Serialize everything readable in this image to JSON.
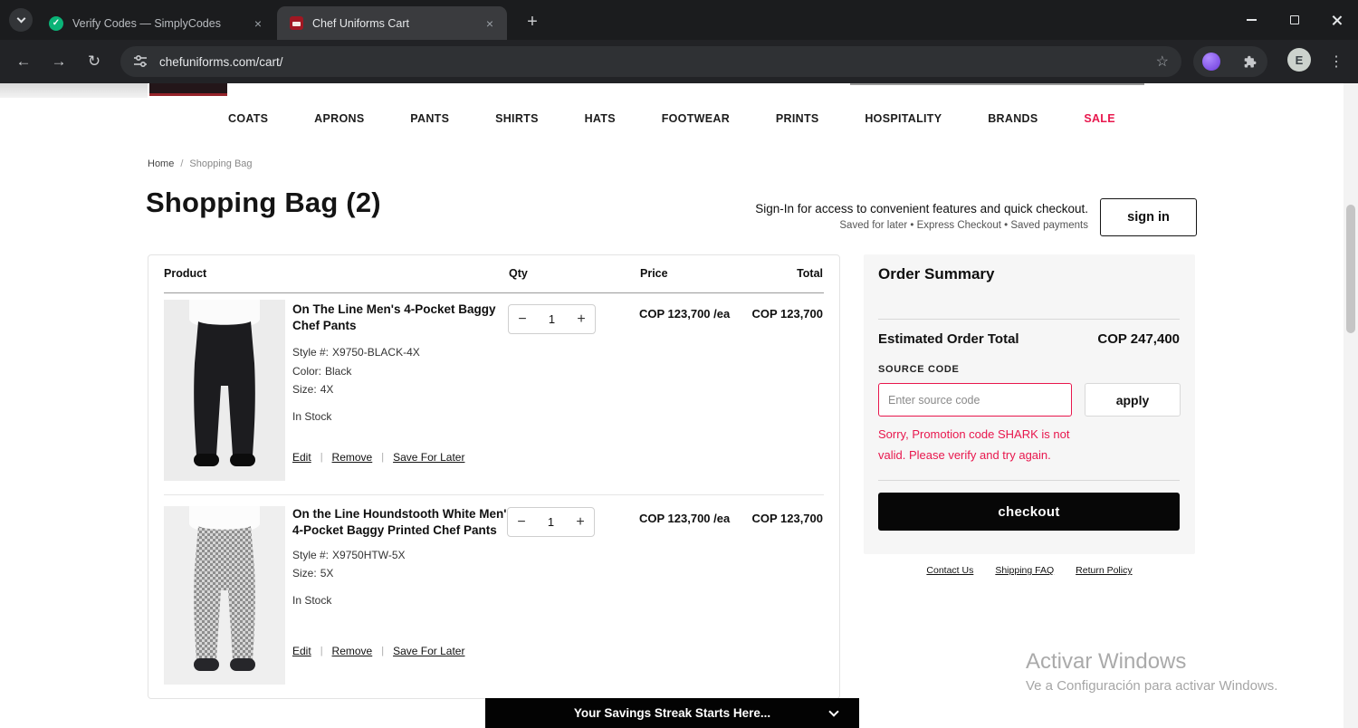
{
  "browser": {
    "tabs": [
      {
        "title": "Verify Codes — SimplyCodes"
      },
      {
        "title": "Chef Uniforms Cart"
      }
    ],
    "url": "chefuniforms.com/cart/",
    "avatar": "E"
  },
  "icons": {
    "back": "←",
    "forward": "→",
    "reload": "↻",
    "star": "☆",
    "more": "⋮",
    "new_tab": "+",
    "close": "×",
    "check": "✓",
    "minus": "−",
    "plus": "+"
  },
  "nav": {
    "items": [
      "COATS",
      "APRONS",
      "PANTS",
      "SHIRTS",
      "HATS",
      "FOOTWEAR",
      "PRINTS",
      "HOSPITALITY",
      "BRANDS",
      "SALE"
    ]
  },
  "breadcrumb": {
    "home": "Home",
    "separator": "/",
    "current": "Shopping Bag"
  },
  "page": {
    "title": "Shopping Bag (2)"
  },
  "signin": {
    "line1": "Sign-In for access to convenient features and quick checkout.",
    "line2": "Saved for later   •   Express Checkout   •   Saved payments",
    "button": "sign in"
  },
  "cart": {
    "headers": {
      "product": "Product",
      "qty": "Qty",
      "price": "Price",
      "total": "Total"
    },
    "link_sep": "|",
    "links": {
      "edit": "Edit",
      "remove": "Remove",
      "save": "Save For Later"
    },
    "items": [
      {
        "title": "On The Line Men's 4-Pocket Baggy Chef Pants",
        "style_label": "Style #:",
        "style_value": "X9750-BLACK-4X",
        "color_label": "Color:",
        "color_value": "Black",
        "size_label": "Size:",
        "size_value": "4X",
        "stock": "In Stock",
        "qty": "1",
        "price": "COP 123,700 /ea",
        "total": "COP 123,700"
      },
      {
        "title": "On the Line Houndstooth White Men's 4-Pocket Baggy Printed Chef Pants",
        "style_label": "Style #:",
        "style_value": "X9750HTW-5X",
        "size_label": "Size:",
        "size_value": "5X",
        "stock": "In Stock",
        "qty": "1",
        "price": "COP 123,700 /ea",
        "total": "COP 123,700"
      }
    ]
  },
  "summary": {
    "title": "Order Summary",
    "estimated_label": "Estimated Order Total",
    "estimated_value": "COP 247,400",
    "source_code_label": "SOURCE CODE",
    "source_placeholder": "Enter source code",
    "apply_label": "apply",
    "error_message": "Sorry, Promotion code SHARK is not valid. Please verify and try again.",
    "checkout_label": "checkout"
  },
  "footer_links": [
    "Contact Us",
    "Shipping FAQ",
    "Return Policy"
  ],
  "watermark": {
    "line1": "Activar Windows",
    "line2": "Ve a Configuración para activar Windows."
  },
  "savings_bar": {
    "label": "Your Savings Streak Starts Here..."
  },
  "colors": {
    "accent": "#e8174d",
    "checkout_bg": "#000000",
    "sale": "#e8174d"
  }
}
